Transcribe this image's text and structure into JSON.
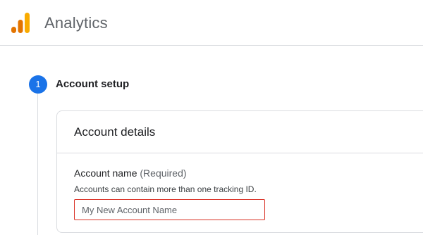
{
  "header": {
    "app_title": "Analytics",
    "logo_icon": "analytics-bars-logo",
    "logo_colors": [
      "#F9AB00",
      "#E37400"
    ]
  },
  "stepper": {
    "step_number": "1",
    "step_title": "Account setup",
    "accent_color": "#1a73e8"
  },
  "card": {
    "title": "Account details",
    "field": {
      "label": "Account name",
      "label_suffix": " (Required)",
      "hint": "Accounts can contain more than one tracking ID.",
      "value": "",
      "placeholder": "My New Account Name",
      "border_color": "#d93025"
    }
  }
}
